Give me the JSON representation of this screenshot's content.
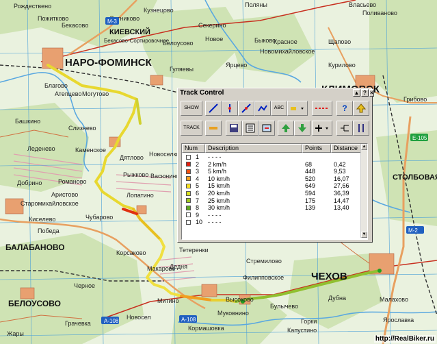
{
  "window": {
    "title": "Track Control",
    "help_label": "?",
    "close_label": "×",
    "pin_label": "▲"
  },
  "toolbar": {
    "show_label": "SHOW",
    "track_label": "TRACK",
    "abc_label": "ABC",
    "help_label": "?"
  },
  "table": {
    "headers": {
      "num": "Num",
      "description": "Description",
      "points": "Points",
      "distance": "Distance"
    },
    "rows": [
      {
        "num": "1",
        "description": "- - - -",
        "points": "",
        "distance": "",
        "color": "#ffffff"
      },
      {
        "num": "2",
        "description": "2 km/h",
        "points": "68",
        "distance": "0,42",
        "color": "#e02010"
      },
      {
        "num": "3",
        "description": "5 km/h",
        "points": "448",
        "distance": "9,53",
        "color": "#f05010"
      },
      {
        "num": "4",
        "description": "10 km/h",
        "points": "520",
        "distance": "16,07",
        "color": "#f8a020"
      },
      {
        "num": "5",
        "description": "15 km/h",
        "points": "649",
        "distance": "27,66",
        "color": "#f8e020"
      },
      {
        "num": "6",
        "description": "20 km/h",
        "points": "594",
        "distance": "36,39",
        "color": "#d8e020"
      },
      {
        "num": "7",
        "description": "25 km/h",
        "points": "175",
        "distance": "14,47",
        "color": "#a0c820"
      },
      {
        "num": "8",
        "description": "30 km/h",
        "points": "139",
        "distance": "13,40",
        "color": "#60a820"
      },
      {
        "num": "9",
        "description": "- - - -",
        "points": "",
        "distance": "",
        "color": "#ffffff"
      },
      {
        "num": "10",
        "description": "- - - -",
        "points": "",
        "distance": "",
        "color": "#ffffff"
      }
    ]
  },
  "map": {
    "labels": {
      "naro": "НАРО-ФОМИНСК",
      "chekhov": "ЧЕХОВ",
      "klimovsk": "КЛИМОВСК",
      "balabanovo": "БАЛАБАНОВО",
      "belousovo": "БЕЛОУСОВО",
      "kievsky": "КИЕВСКИЙ",
      "stolbovaya": "СТОЛБОВАЯ",
      "atepcevo": "Атепцево",
      "slizneva": "Слизнево",
      "kamenskoe": "Каменское",
      "datyakovo": "Дятлово",
      "ryzhkovo": "Рыжково",
      "romanovo": "Романово",
      "aristovo": "Аристово",
      "staromikhailovskoe": "Старомихайловское",
      "chubarovo": "Чубарово",
      "lopatino": "Лопатино",
      "korsakovo": "Корсаково",
      "makarovo": "Макарово",
      "mitino": "Митино",
      "vysokovo": "Высоково",
      "mukovnino": "Муковнино",
      "kormashovka": "Кормашовка",
      "bulychevo": "Булычево",
      "stremilovo": "Стремилово",
      "filippovskoe": "Филипповское",
      "dedny": "Дедня",
      "teterenki": "Тетеренки",
      "dubna": "Дубна",
      "kurilovo": "Курилово",
      "gulyaevy": "Гуляевы",
      "novoselki": "Новоселки",
      "vasyunino": "Васюнино",
      "grachevka": "Грачевка",
      "kiselevo": "Киселево",
      "bashkino": "Башкино",
      "ledenevo": "Леденево",
      "dobrino": "Добрино",
      "pobeda": "Победа",
      "blagovo": "Благово",
      "mogutovo": "Могутово",
      "sekerino": "Секерино",
      "belousovo2": "Белоусово",
      "bykovo": "Быково",
      "shchapovo": "Щапово",
      "krasnoe": "Красное",
      "novomikhailovskoe": "Новомихайловское",
      "polivanovo": "Поливаново",
      "vlasyevo": "Власьево",
      "malakhovo": "Малахово",
      "gorki": "Горки",
      "kapustino": "Капустино",
      "novosel": "Новосел",
      "yaroslavka": "Ярославка",
      "chernoe": "Черное",
      "zhary": "Жары",
      "pozhitkovo": "Пожитково",
      "bekasovo": "Бекасово",
      "kuznecovo": "Кузнецово",
      "novoe": "Новое",
      "polyany": "Поляны",
      "ryzhovo": "Ярцево",
      "rozhnovo": "Рождествено",
      "sotnikovo": "Сотниково",
      "gribnovo": "Грибово",
      "bekasovo_sort": "Бекасово-Сортировочное",
      "road_a108": "А-108",
      "road_a108b": "А-108",
      "road_m2": "М-2",
      "road_e105": "Е-105",
      "road_m3": "М-3"
    },
    "footer": "http://RealBiker.ru"
  }
}
